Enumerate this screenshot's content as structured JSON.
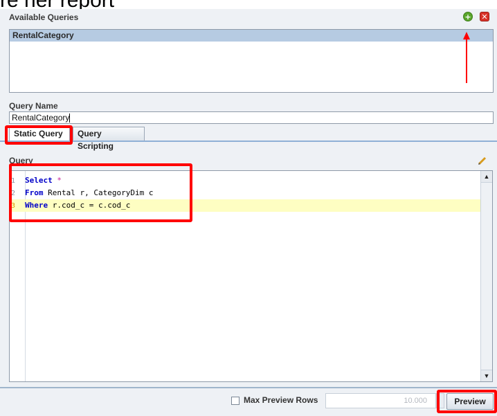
{
  "slide": {
    "top_text": "re her report"
  },
  "queries_panel": {
    "title": "Available Queries",
    "items": [
      "RentalCategory"
    ],
    "add_icon": "add-icon",
    "remove_icon": "remove-icon"
  },
  "query_name": {
    "label": "Query Name",
    "value": "RentalCategory"
  },
  "tabs": [
    {
      "label": "Static Query",
      "active": true
    },
    {
      "label": "Query Scripting",
      "active": false
    }
  ],
  "editor": {
    "label": "Query",
    "edit_icon": "pencil-icon",
    "lines": [
      {
        "number": "1",
        "keyword": "Select",
        "rest": " *"
      },
      {
        "number": "2",
        "keyword": "From",
        "rest": " Rental r, CategoryDim c"
      },
      {
        "number": "3",
        "keyword": "Where",
        "rest": " r.cod_c = c.cod_c"
      }
    ]
  },
  "footer": {
    "max_rows_label": "Max Preview Rows",
    "max_rows_checked": false,
    "max_rows_value": "10.000",
    "preview_label": "Preview"
  },
  "colors": {
    "annotation": "#ff0000",
    "selection": "#b6cbe2",
    "highlight_line": "#fefec2"
  }
}
